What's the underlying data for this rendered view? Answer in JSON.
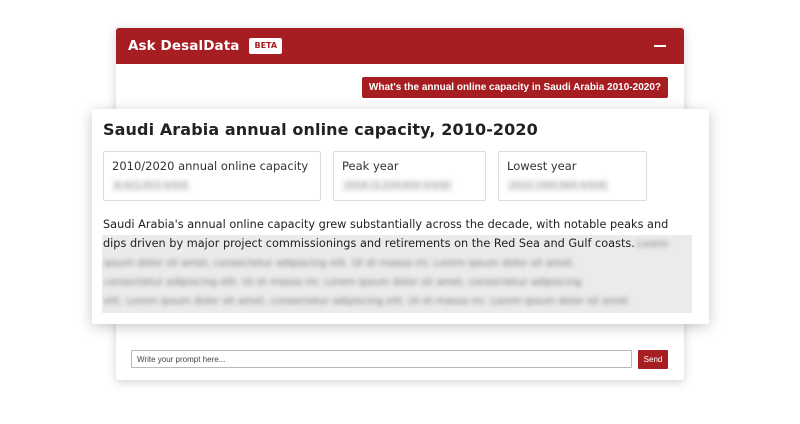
{
  "chat": {
    "title": "Ask DesalData",
    "badge": "BETA",
    "user_message": "What's the annual online capacity in Saudi Arabia 2010-2020?",
    "prompt_placeholder": "Write your prompt here...",
    "send_label": "Send"
  },
  "result": {
    "title": "Saudi Arabia annual online capacity, 2010-2020",
    "stats": [
      {
        "label": "2010/2020 annual online capacity",
        "value": "6,411,811 m3/d"
      },
      {
        "label": "Peak year",
        "value": "2016 (1,234,832 m3/d)"
      },
      {
        "label": "Lowest year",
        "value": "2011 (300,944 m3/d)"
      }
    ],
    "summary": "Saudi Arabia's annual online capacity grew substantially across the decade, with notable peaks and dips driven by major project commissionings and retirements on the Red Sea and Gulf coasts.",
    "blurred_lines": [
      "Lorem",
      "ipsum dolor sit amet, consectetur adipiscing elit. Ut et massa mi. Lorem ipsum dolor sit amet,",
      "consectetur adipiscing elit. Ut et massa mi. Lorem ipsum dolor sit amet, consectetur adipiscing",
      "elit. Lorem ipsum dolor sit amet, consectetur adipiscing elit. Ut et massa mi. Lorem ipsum dolor sit amet"
    ]
  },
  "colors": {
    "brand": "#a61e22"
  }
}
